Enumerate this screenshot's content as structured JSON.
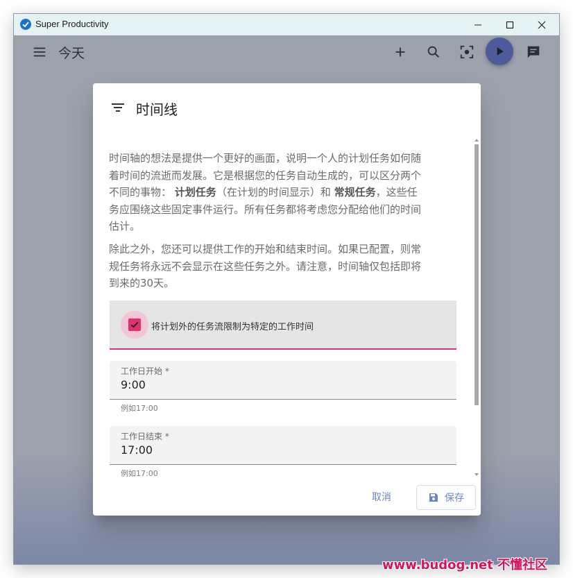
{
  "window": {
    "app_title": "Super Productivity"
  },
  "appbar": {
    "page_title": "今天",
    "icons": [
      "menu-icon",
      "add-icon",
      "search-icon",
      "focus-icon",
      "play-icon",
      "chat-icon"
    ]
  },
  "dialog": {
    "title": "时间线",
    "para1": {
      "line1": "时间轴的想法是提供一个更好的画面，说明一个人的计划任务如何随",
      "line2": "着时间的流逝而发展。它是根据您的任务自动生成的，可以区分两个",
      "line3_pre": "不同的事物：",
      "line3_b1": "计划任务",
      "line3_mid": "（在计划的时间显示）和",
      "line3_b2": "常规任务",
      "line3_post": "，这些任",
      "line4": "务应围绕这些固定事件运行。所有任务都将考虑您分配给他们的时间",
      "line5": "估计。"
    },
    "para2": {
      "line1": "除此之外，您还可以提供工作的开始和结束时间。如果已配置，则常",
      "line2": "规任务将永远不会显示在这些任务之外。请注意，时间轴仅包括即将",
      "line3": "到来的30天。"
    },
    "checkbox": {
      "label": "将计划外的任务流限制为特定的工作时间",
      "checked": true
    },
    "field_start": {
      "label": "工作日开始 *",
      "value": "9:00",
      "hint": "例如17:00"
    },
    "field_end": {
      "label": "工作日结束 *",
      "value": "17:00",
      "hint": "例如17:00"
    },
    "cancel_label": "取消",
    "save_label": "保存"
  },
  "watermark": "www.budog.net 不懂社区",
  "colors": {
    "accent": "#e0316c",
    "primary": "#4d5b9b",
    "button_text": "#6b86c4"
  }
}
